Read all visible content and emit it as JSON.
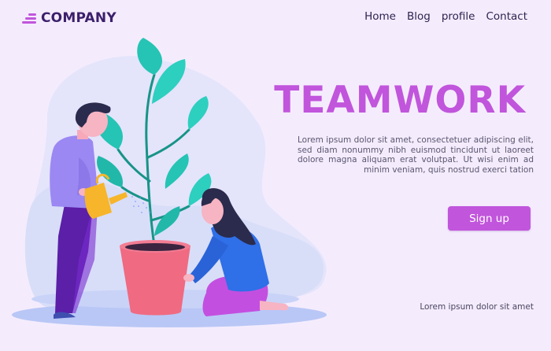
{
  "brand": {
    "name": "COMPANY",
    "icon": "stacked-bars-logo-icon"
  },
  "nav": {
    "items": [
      {
        "label": "Home"
      },
      {
        "label": "Blog"
      },
      {
        "label": "profile"
      },
      {
        "label": "Contact"
      }
    ]
  },
  "hero": {
    "title": "TEAMWORK",
    "body": "Lorem ipsum dolor sit amet, consectetuer adipiscing elit, sed diam nonummy nibh euismod tincidunt ut laoreet dolore magna aliquam erat volutpat. Ut wisi enim ad minim veniam, quis nostrud exerci tation",
    "button_label": "Sign up",
    "footer_note": "Lorem ipsum dolor sit amet"
  },
  "colors": {
    "background": "#f4ecfd",
    "accent": "#c155dc",
    "brand_text": "#3b1f6b",
    "leaf": "#25c4b4",
    "pot": "#f06a82"
  }
}
